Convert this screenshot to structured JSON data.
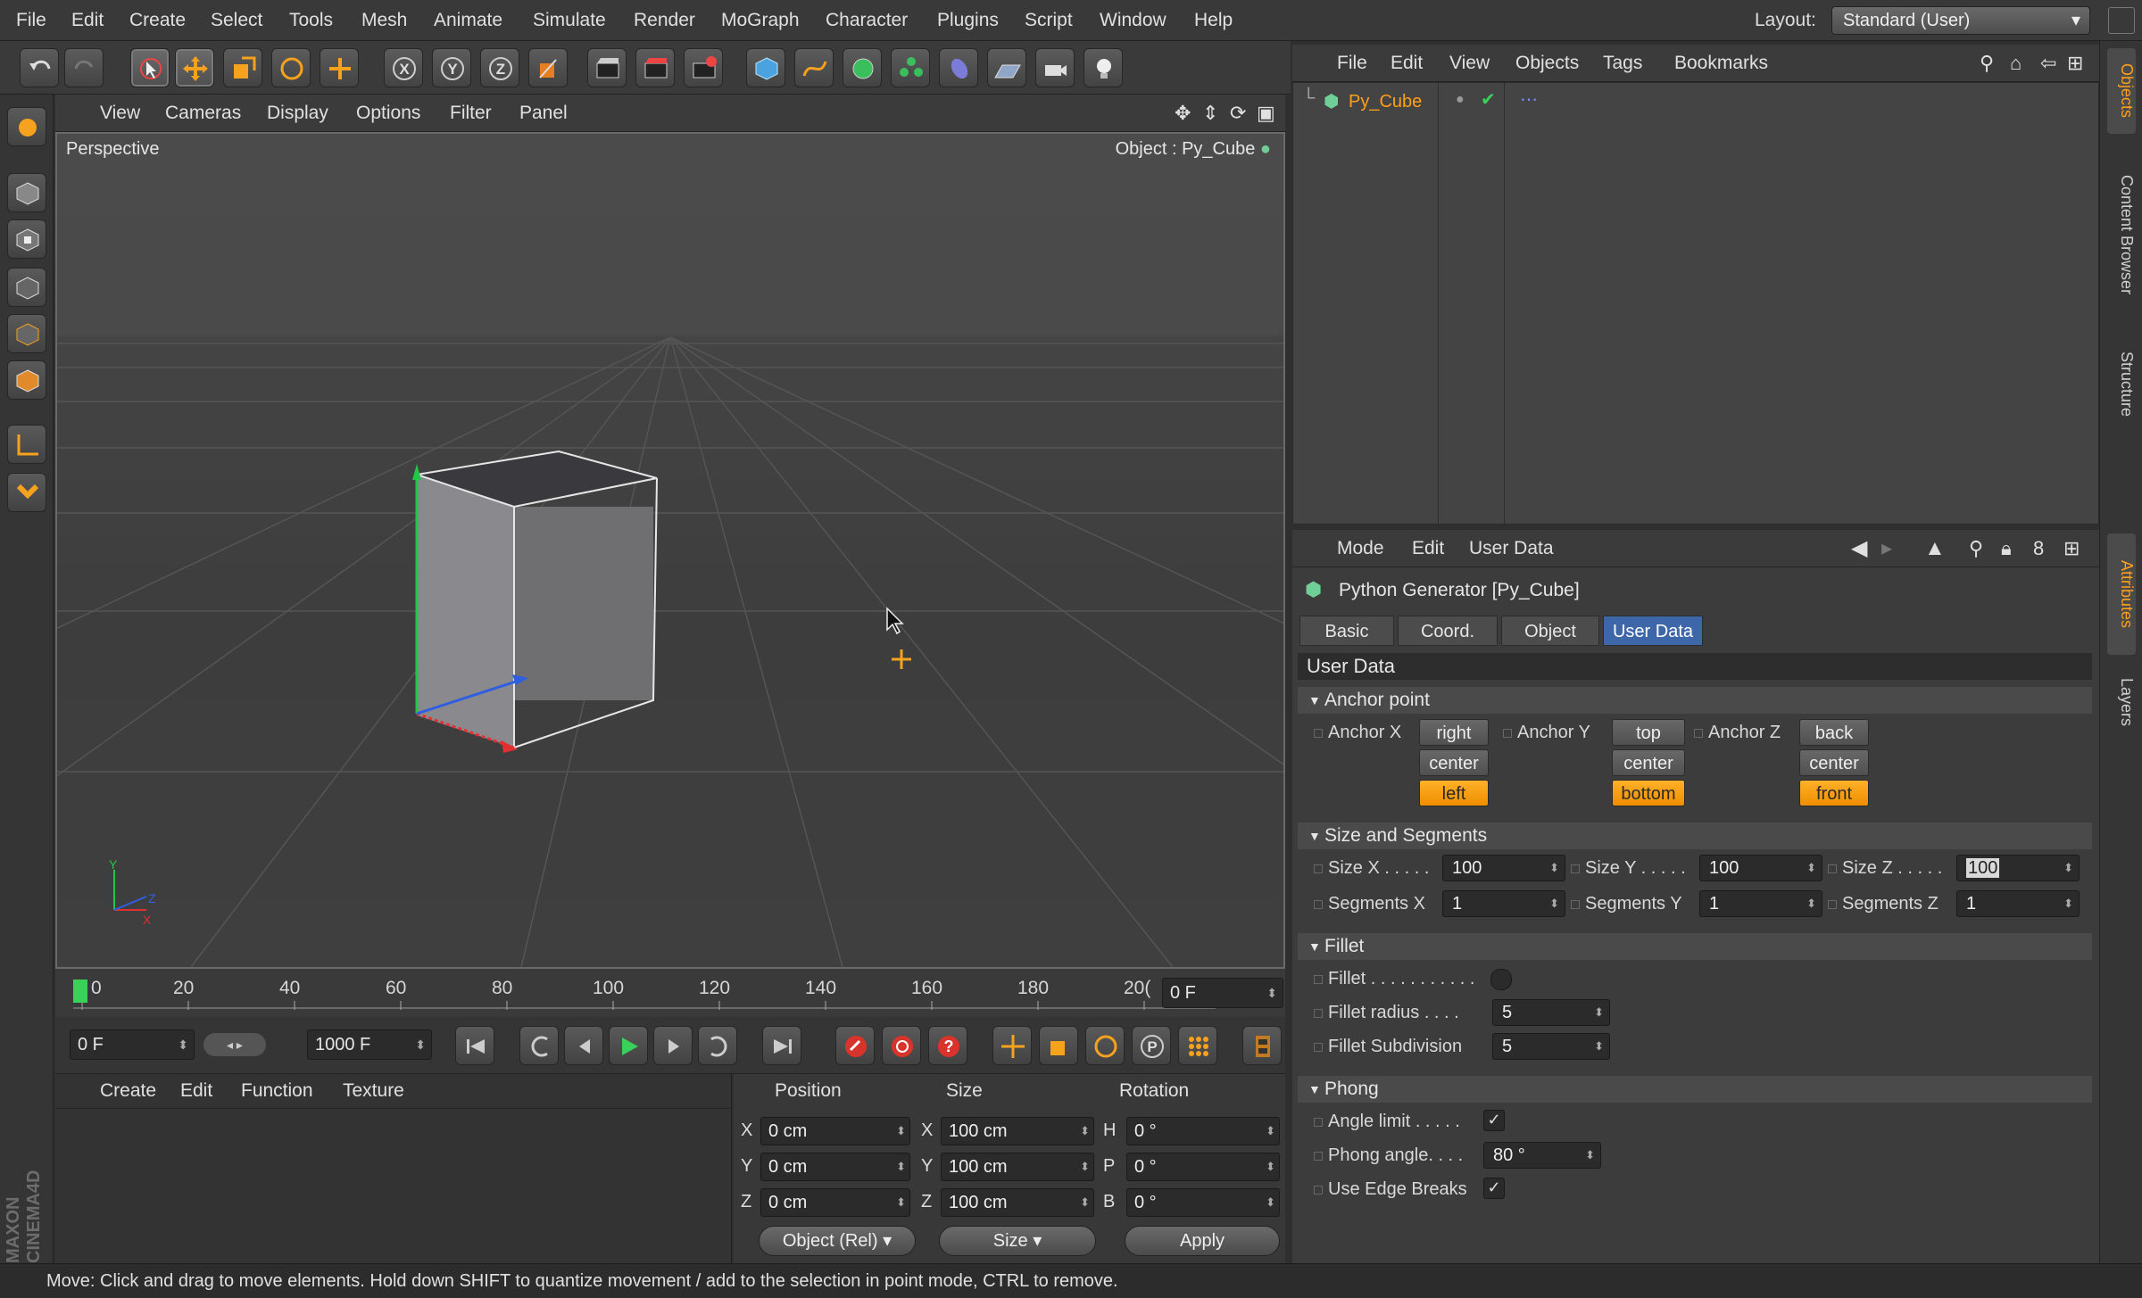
{
  "menubar": {
    "items": [
      "File",
      "Edit",
      "Create",
      "Select",
      "Tools",
      "Mesh",
      "Animate",
      "Simulate",
      "Render",
      "MoGraph",
      "Character",
      "Plugins",
      "Script",
      "Window",
      "Help"
    ],
    "layout_label": "Layout:",
    "layout_value": "Standard (User)"
  },
  "viewport": {
    "menu": [
      "View",
      "Cameras",
      "Display",
      "Options",
      "Filter",
      "Panel"
    ],
    "label": "Perspective",
    "object_label": "Object : Py_Cube"
  },
  "timeline": {
    "ticks": [
      "0",
      "20",
      "40",
      "60",
      "80",
      "100",
      "120",
      "140",
      "160",
      "180",
      "20("
    ],
    "current_frame": "0 F"
  },
  "playbar": {
    "start_frame": "0 F",
    "end_frame": "1000 F"
  },
  "material_manager": {
    "menu": [
      "Create",
      "Edit",
      "Function",
      "Texture"
    ]
  },
  "coordinates": {
    "headers": [
      "Position",
      "Size",
      "Rotation"
    ],
    "rows": [
      {
        "axis": "X",
        "pos": "0 cm",
        "size_axis": "X",
        "size": "100 cm",
        "rot_axis": "H",
        "rot": "0 °"
      },
      {
        "axis": "Y",
        "pos": "0 cm",
        "size_axis": "Y",
        "size": "100 cm",
        "rot_axis": "P",
        "rot": "0 °"
      },
      {
        "axis": "Z",
        "pos": "0 cm",
        "size_axis": "Z",
        "size": "100 cm",
        "rot_axis": "B",
        "rot": "0 °"
      }
    ],
    "mode": "Object (Rel)",
    "size_mode": "Size",
    "apply": "Apply"
  },
  "object_manager": {
    "menu": [
      "File",
      "Edit",
      "View",
      "Objects",
      "Tags",
      "Bookmarks"
    ],
    "object_name": "Py_Cube"
  },
  "attributes": {
    "menu": [
      "Mode",
      "Edit",
      "User Data"
    ],
    "title": "Python Generator [Py_Cube]",
    "tabs": [
      "Basic",
      "Coord.",
      "Object",
      "User Data"
    ],
    "section_title": "User Data",
    "anchor": {
      "title": "Anchor point",
      "x_label": "Anchor X",
      "y_label": "Anchor Y",
      "z_label": "Anchor Z",
      "x_options": [
        "right",
        "center",
        "left"
      ],
      "y_options": [
        "top",
        "center",
        "bottom"
      ],
      "z_options": [
        "back",
        "center",
        "front"
      ],
      "x_selected": "left",
      "y_selected": "bottom",
      "z_selected": "front"
    },
    "size_segments": {
      "title": "Size and Segments",
      "size_x_label": "Size X . . . . .",
      "size_x": "100",
      "size_y_label": "Size Y . . . . .",
      "size_y": "100",
      "size_z_label": "Size Z . . . . .",
      "size_z": "100",
      "seg_x_label": "Segments X",
      "seg_x": "1",
      "seg_y_label": "Segments Y",
      "seg_y": "1",
      "seg_z_label": "Segments Z",
      "seg_z": "1"
    },
    "fillet": {
      "title": "Fillet",
      "fillet_label": "Fillet . . . . . . . . . . .",
      "radius_label": "Fillet radius . . . .",
      "radius": "5",
      "subdiv_label": "Fillet Subdivision",
      "subdiv": "5"
    },
    "phong": {
      "title": "Phong",
      "angle_limit_label": "Angle limit . . . . .",
      "phong_angle_label": "Phong angle. . . .",
      "phong_angle": "80 °",
      "edge_breaks_label": "Use Edge Breaks",
      "check": "✓"
    }
  },
  "side_tabs": [
    "Objects",
    "Content Browser",
    "Structure",
    "Attributes",
    "Layers"
  ],
  "brand": "MAXON CINEMA4D",
  "status": "Move: Click and drag to move elements. Hold down SHIFT to quantize movement / add to the selection in point mode, CTRL to remove."
}
